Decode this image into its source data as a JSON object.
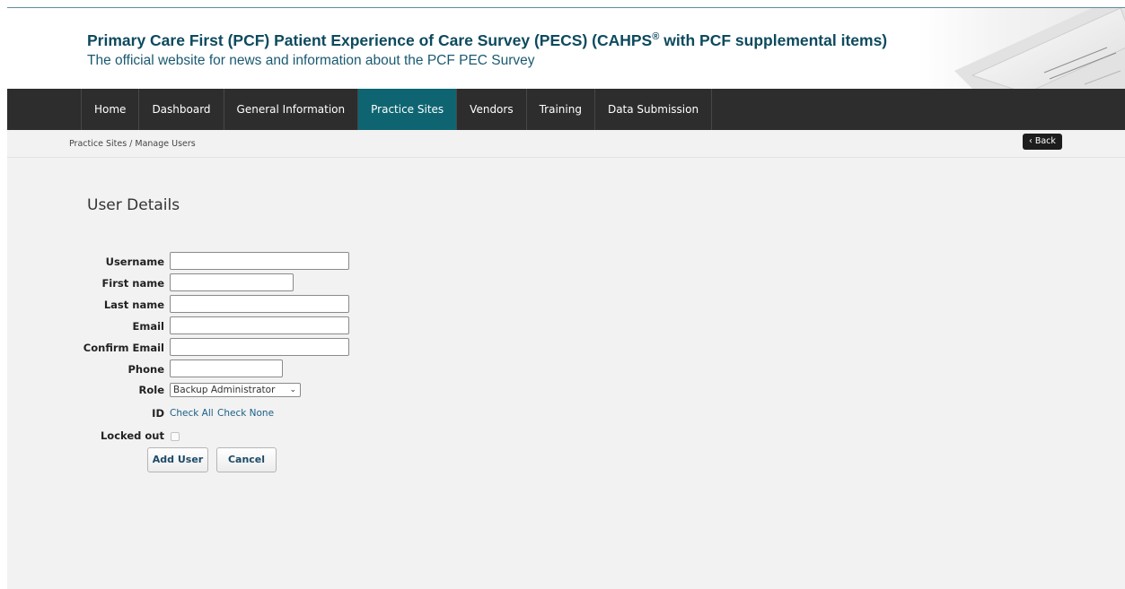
{
  "header": {
    "title": "Primary Care First (PCF) Patient Experience of Care Survey (PECS) (CAHPS",
    "title_registered": "®",
    "title_suffix": " with PCF supplemental items)",
    "subtitle": "The official website for news and information about the PCF PEC Survey"
  },
  "nav": {
    "items": [
      {
        "label": "Home"
      },
      {
        "label": "Dashboard"
      },
      {
        "label": "General Information"
      },
      {
        "label": "Practice Sites",
        "active": true
      },
      {
        "label": "Vendors"
      },
      {
        "label": "Training"
      },
      {
        "label": "Data Submission"
      }
    ]
  },
  "breadcrumb": {
    "text": "Practice Sites  /  Manage Users",
    "back_label": "‹ Back"
  },
  "form": {
    "title": "User Details",
    "username_label": "Username",
    "first_name_label": "First name",
    "last_name_label": "Last name",
    "email_label": "Email",
    "confirm_email_label": "Confirm Email",
    "phone_label": "Phone",
    "role_label": "Role",
    "role_value": "Backup Administrator",
    "id_label": "ID",
    "check_all": "Check All",
    "check_none": "Check None",
    "locked_out_label": "Locked out",
    "locked_out_checked": false,
    "add_user_button": "Add User",
    "cancel_button": "Cancel"
  },
  "colors": {
    "title": "#0d4a5e",
    "nav_bg": "#2d2d2d",
    "nav_active": "#0e6571",
    "content_bg": "#f2f2f2",
    "link": "#1a5f87"
  },
  "icons": {
    "back": "chevron-left-icon",
    "role_dropdown": "chevron-down-icon"
  }
}
